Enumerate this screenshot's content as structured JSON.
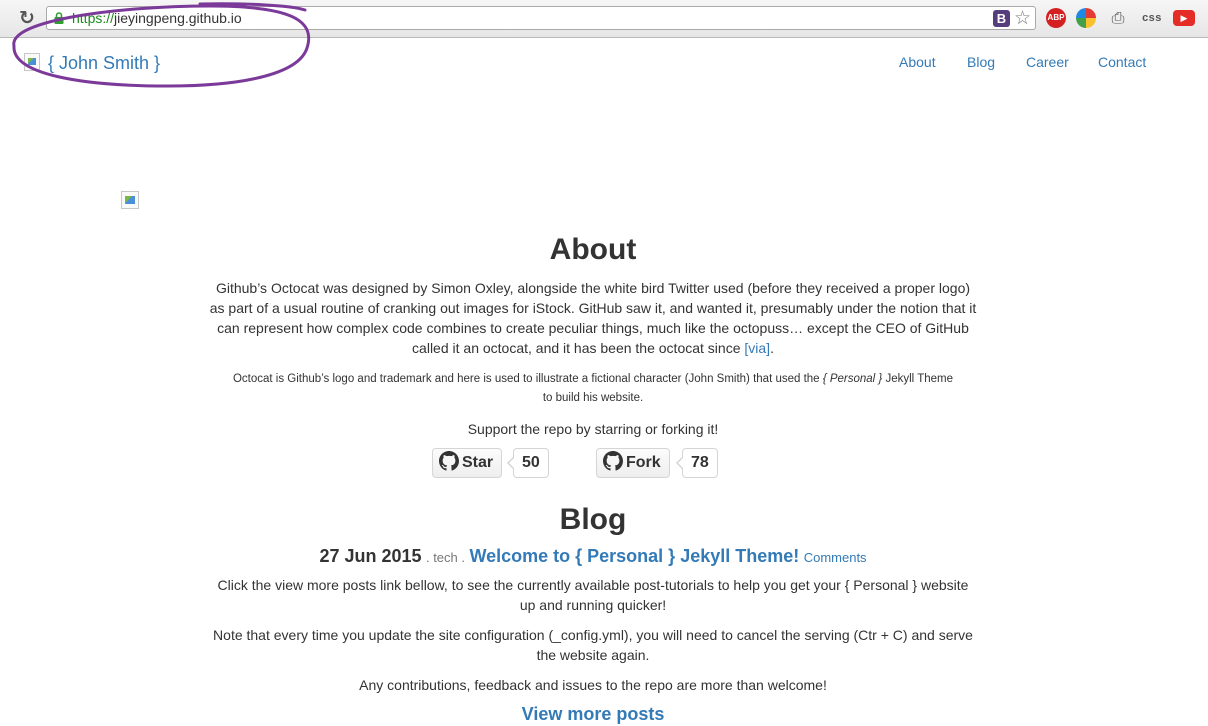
{
  "browser": {
    "url_scheme": "https://",
    "url_host": "jieyingpeng.github.io",
    "bookmark_badge": "B",
    "extensions": {
      "adblock": "ABP",
      "css": "css"
    }
  },
  "navbar": {
    "brand": "{ John Smith }",
    "links": [
      "About",
      "Blog",
      "Career",
      "Contact"
    ]
  },
  "annotation": {
    "color": "#7b3a99"
  },
  "about": {
    "heading": "About",
    "paragraph": "Github’s Octocat was designed by Simon Oxley, alongside the white bird Twitter used (before they received a proper logo) as part of a usual routine of cranking out images for iStock. GitHub saw it, and wanted it, presumably under the notion that it can represent how complex code combines to create peculiar things, much like the octopuss… except the CEO of GitHub called it an octocat, and it has been the octocat since",
    "via_link": "[via]",
    "note_before": "Octocat is Github’s logo and trademark and here is used to illustrate a fictional character (John Smith) that used the",
    "note_theme": "{ Personal }",
    "note_after": "Jekyll Theme to build his website.",
    "support": "Support the repo by starring or forking it!",
    "star_label": "Star",
    "star_count": "50",
    "fork_label": "Fork",
    "fork_count": "78"
  },
  "blog": {
    "heading": "Blog",
    "post": {
      "date": "27 Jun 2015",
      "category": ". tech .",
      "title": "Welcome to { Personal } Jekyll Theme!",
      "comments": "Comments",
      "p1": "Click the view more posts link bellow, to see the currently available post-tutorials to help you get your { Personal } website up and running quicker!",
      "p2": "Note that every time you update the site configuration (_config.yml), you will need to cancel the serving (Ctr + C) and serve the website again.",
      "p3": "Any contributions, feedback and issues to the repo are more than welcome!"
    },
    "view_more": "View more posts"
  },
  "colors": {
    "link": "#337ab7",
    "text": "#333333",
    "secure_url": "#1a8a1a"
  }
}
